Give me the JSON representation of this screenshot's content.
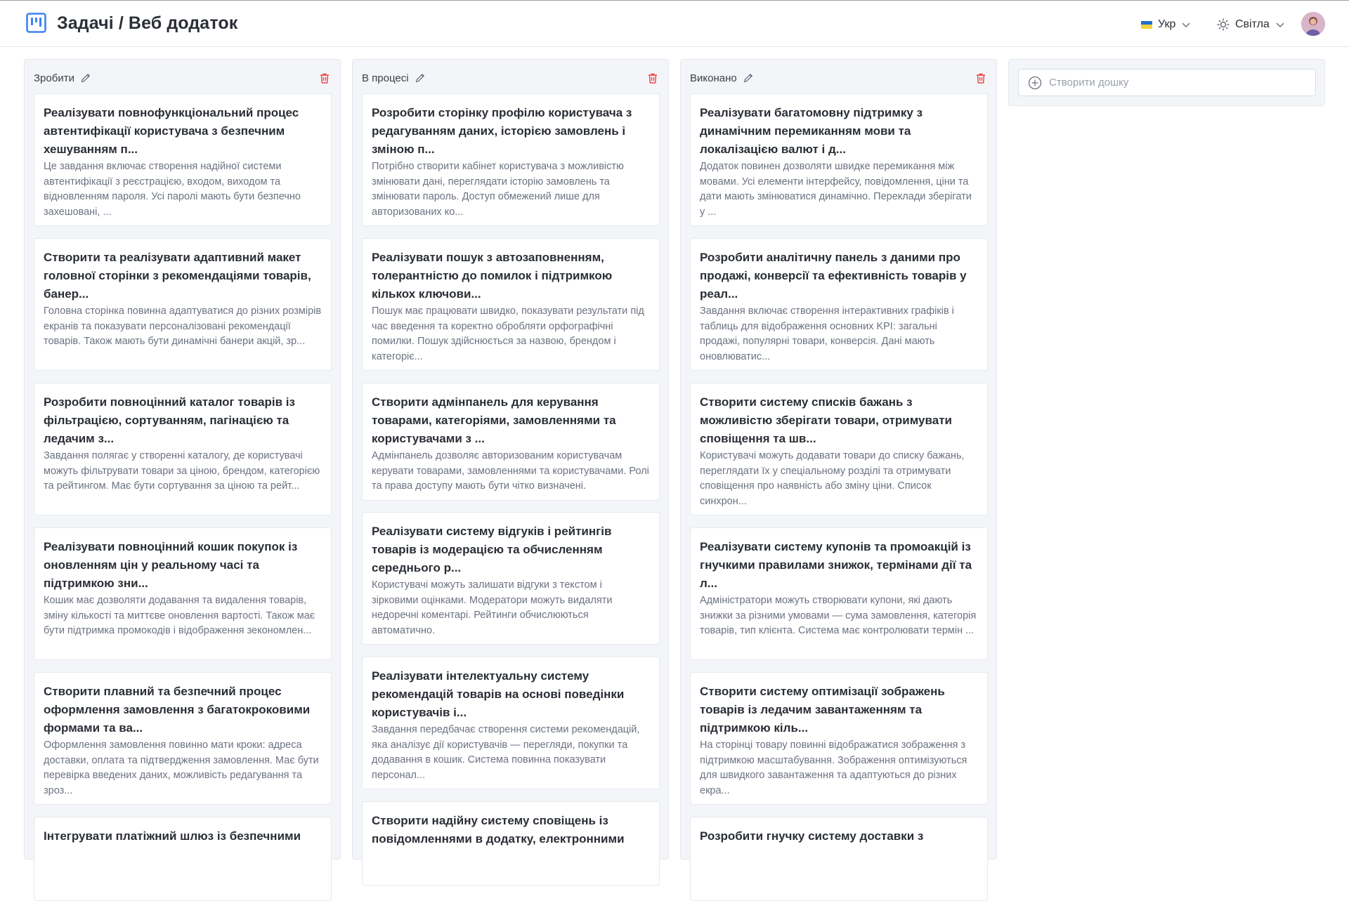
{
  "header": {
    "title": "Задачі / Веб додаток",
    "language": "Укр",
    "theme": "Світла"
  },
  "columns": [
    {
      "name": "Зробити",
      "cards": [
        {
          "title": "Реалізувати повнофункціональний процес автентифікації користувача з безпечним хешуванням п...",
          "desc": "Це завдання включає створення надійної системи автентифікації з реєстрацією, входом, виходом та відновленням пароля. Усі паролі мають бути безпечно захешовані, ..."
        },
        {
          "title": "Створити та реалізувати адаптивний макет головної сторінки з рекомендаціями товарів, банер...",
          "desc": "Головна сторінка повинна адаптуватися до різних розмірів екранів та показувати персоналізовані рекомендації товарів. Також мають бути динамічні банери акцій, зр..."
        },
        {
          "title": "Розробити повноцінний каталог товарів із фільтрацією, сортуванням, пагінацією та ледачим з...",
          "desc": "Завдання полягає у створенні каталогу, де користувачі можуть фільтрувати товари за ціною, брендом, категорією та рейтингом. Має бути сортування за ціною та рейт..."
        },
        {
          "title": "Реалізувати повноцінний кошик покупок із оновленням цін у реальному часі та підтримкою зни...",
          "desc": "Кошик має дозволяти додавання та видалення товарів, зміну кількості та миттєве оновлення вартості. Також має бути підтримка промокодів і відображення зекономлен..."
        },
        {
          "title": "Створити плавний та безпечний процес оформлення замовлення з багатокроковими формами та ва...",
          "desc": "Оформлення замовлення повинно мати кроки: адреса доставки, оплата та підтвердження замовлення. Має бути перевірка введених даних, можливість редагування та зроз..."
        },
        {
          "title": "Інтегрувати платіжний шлюз із безпечними",
          "desc": ""
        }
      ]
    },
    {
      "name": "В процесі",
      "cards": [
        {
          "title": "Розробити сторінку профілю користувача з редагуванням даних, історією замовлень і зміною п...",
          "desc": "Потрібно створити кабінет користувача з можливістю змінювати дані, переглядати історію замовлень та змінювати пароль. Доступ обмежений лише для авторизованих ко..."
        },
        {
          "title": "Реалізувати пошук з автозаповненням, толерантністю до помилок і підтримкою кількох ключови...",
          "desc": "Пошук має працювати швидко, показувати результати під час введення та коректно обробляти орфографічні помилки. Пошук здійснюється за назвою, брендом і категоріє..."
        },
        {
          "title": "Створити адмінпанель для керування товарами, категоріями, замовленнями та користувачами з ...",
          "desc": "Адмінпанель дозволяє авторизованим користувачам керувати товарами, замовленнями та користувачами. Ролі та права доступу мають бути чітко визначені."
        },
        {
          "title": "Реалізувати систему відгуків і рейтингів товарів із модерацією та обчисленням середнього р...",
          "desc": "Користувачі можуть залишати відгуки з текстом і зірковими оцінками. Модератори можуть видаляти недоречні коментарі. Рейтинги обчислюються автоматично."
        },
        {
          "title": "Реалізувати інтелектуальну систему рекомендацій товарів на основі поведінки користувачів і...",
          "desc": "Завдання передбачає створення системи рекомендацій, яка аналізує дії користувачів — перегляди, покупки та додавання в кошик. Система повинна показувати персонал..."
        },
        {
          "title": "Створити надійну систему сповіщень із повідомленнями в додатку, електронними",
          "desc": ""
        }
      ]
    },
    {
      "name": "Виконано",
      "cards": [
        {
          "title": "Реалізувати багатомовну підтримку з динамічним перемиканням мови та локалізацією валют і д...",
          "desc": "Додаток повинен дозволяти швидке перемикання між мовами. Усі елементи інтерфейсу, повідомлення, ціни та дати мають змінюватися динамічно. Переклади зберігати у ..."
        },
        {
          "title": "Розробити аналітичну панель з даними про продажі, конверсії та ефективність товарів у реал...",
          "desc": "Завдання включає створення інтерактивних графіків і таблиць для відображення основних KPI: загальні продажі, популярні товари, конверсія. Дані мають оновлюватис..."
        },
        {
          "title": "Створити систему списків бажань з можливістю зберігати товари, отримувати сповіщення та шв...",
          "desc": "Користувачі можуть додавати товари до списку бажань, переглядати їх у спеціальному розділі та отримувати сповіщення про наявність або зміну ціни. Список синхрон..."
        },
        {
          "title": "Реалізувати систему купонів та промоакцій із гнучкими правилами знижок, термінами дії та л...",
          "desc": "Адміністратори можуть створювати купони, які дають знижки за різними умовами — сума замовлення, категорія товарів, тип клієнта. Система має контролювати термін ..."
        },
        {
          "title": "Створити систему оптимізації зображень товарів із ледачим завантаженням та підтримкою кіль...",
          "desc": "На сторінці товару повинні відображатися зображення з підтримкою масштабування. Зображення оптимізуються для швидкого завантаження та адаптуються до різних екра..."
        },
        {
          "title": "Розробити гнучку систему доставки з",
          "desc": ""
        }
      ]
    }
  ],
  "add_board": {
    "placeholder": "Створити дошку"
  }
}
